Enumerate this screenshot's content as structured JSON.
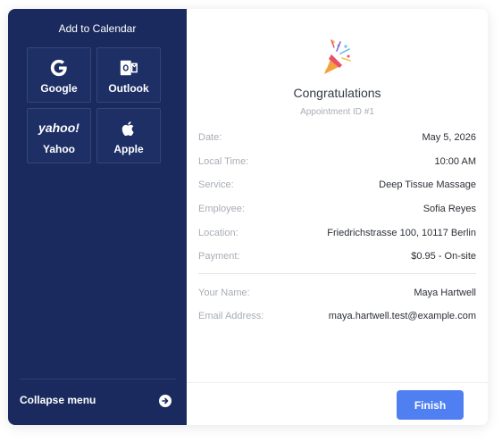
{
  "sidebar": {
    "title": "Add to Calendar",
    "calendars": [
      {
        "label": "Google",
        "icon": "google-icon"
      },
      {
        "label": "Outlook",
        "icon": "outlook-icon"
      },
      {
        "label": "Yahoo",
        "icon": "yahoo-icon",
        "logo_text": "yahoo!"
      },
      {
        "label": "Apple",
        "icon": "apple-icon"
      }
    ],
    "collapse_label": "Collapse menu",
    "collapse_icon": "arrow-right-circle-icon"
  },
  "main": {
    "icon": "party-popper-icon",
    "heading": "Congratulations",
    "subheading": "Appointment ID #1",
    "details": [
      {
        "label": "Date:",
        "value": "May 5, 2026"
      },
      {
        "label": "Local Time:",
        "value": "10:00 AM"
      },
      {
        "label": "Service:",
        "value": "Deep Tissue Massage"
      },
      {
        "label": "Employee:",
        "value": "Sofia Reyes"
      },
      {
        "label": "Location:",
        "value": "Friedrichstrasse 100, 10117 Berlin"
      },
      {
        "label": "Payment:",
        "value": "$0.95 - On-site"
      }
    ],
    "customer": [
      {
        "label": "Your Name:",
        "value": "Maya Hartwell"
      },
      {
        "label": "Email Address:",
        "value": "maya.hartwell.test@example.com"
      }
    ],
    "finish_label": "Finish"
  },
  "colors": {
    "sidebar_bg": "#1a2a5e",
    "accent": "#4f7ff0"
  }
}
